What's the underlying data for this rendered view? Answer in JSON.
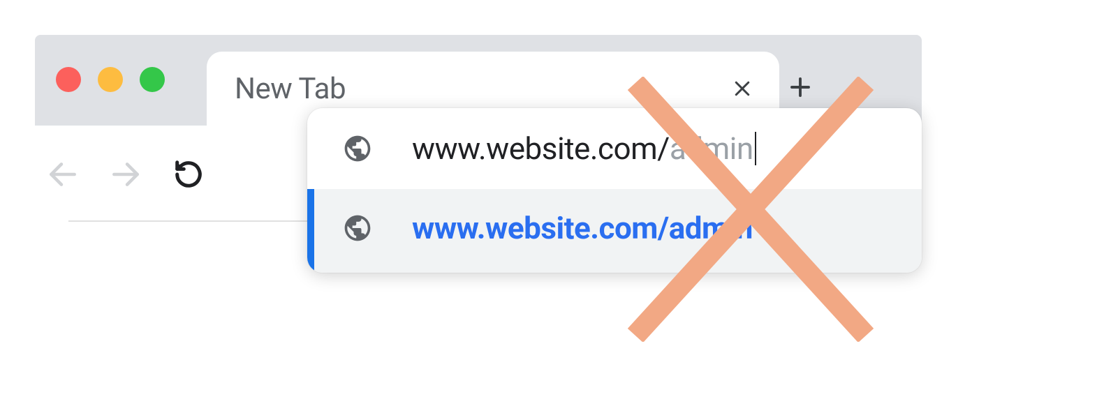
{
  "tab": {
    "title": "New Tab"
  },
  "omnibox": {
    "typed": "www.website.com/",
    "autocompleted": "admin"
  },
  "suggestion": {
    "text": "www.website.com/admin"
  },
  "colors": {
    "traffic_red": "#fc605c",
    "traffic_yellow": "#fdbc40",
    "traffic_green": "#34c749",
    "tab_strip_bg": "#dfe1e5",
    "suggestion_link": "#2a6ef0",
    "suggestion_accent": "#1a73e8",
    "overlay_x": "#f2a884"
  }
}
